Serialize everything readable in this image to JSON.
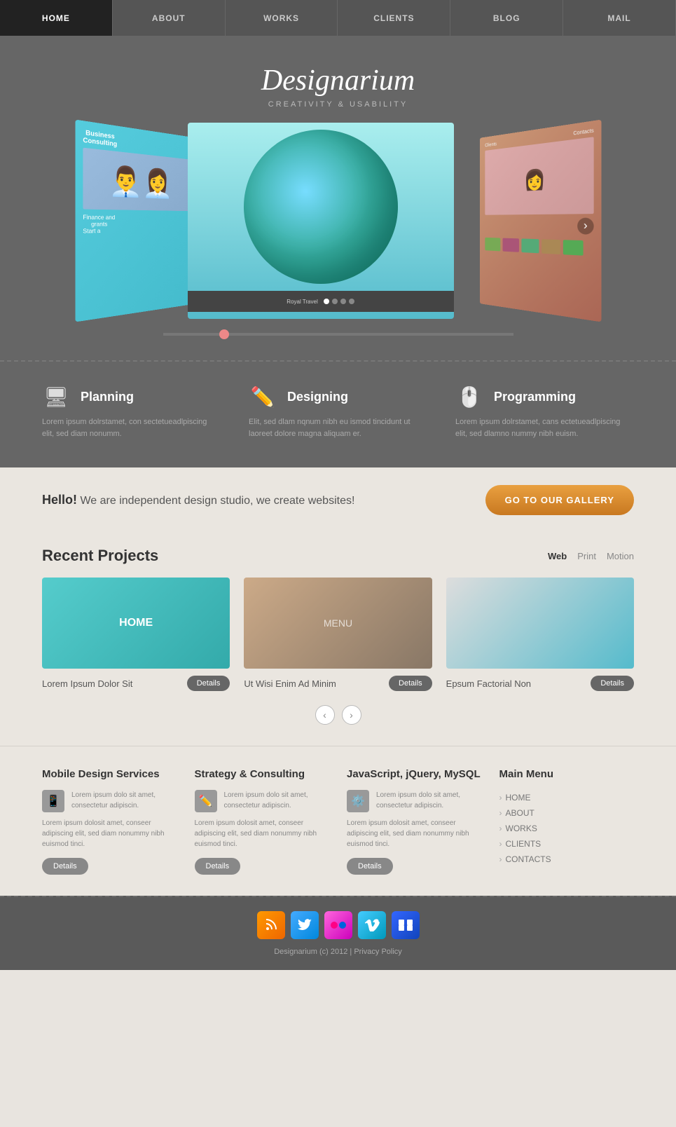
{
  "nav": {
    "items": [
      {
        "label": "HOME",
        "active": true
      },
      {
        "label": "ABOUT",
        "active": false
      },
      {
        "label": "WORKS",
        "active": false
      },
      {
        "label": "CLIENTS",
        "active": false
      },
      {
        "label": "BLOG",
        "active": false
      },
      {
        "label": "MAIL",
        "active": false
      }
    ]
  },
  "hero": {
    "title": "Designarium",
    "subtitle": "CREATIVITY & USABILITY"
  },
  "features": [
    {
      "id": "planning",
      "icon": "🖥",
      "title": "Planning",
      "text": "Lorem ipsum dolrstamet, con sectetueadlpiscing elit, sed diam nonumm."
    },
    {
      "id": "designing",
      "icon": "✏",
      "title": "Designing",
      "text": "Elit, sed dlam nqnum nibh eu ismod tincidunt ut laoreet dolore magna aliquam er."
    },
    {
      "id": "programming",
      "icon": "🖱",
      "title": "Programming",
      "text": "Lorem ipsum dolrstamet, cans ectetueadlpiscing elit, sed dlamno nummy nibh euism."
    }
  ],
  "hello": {
    "prefix": "Hello!",
    "text": " We are independent design studio, we create websites!",
    "button": "GO TO OUR GALLERY"
  },
  "recent": {
    "title": "Recent Projects",
    "filters": [
      "Web",
      "Print",
      "Motion"
    ],
    "active_filter": "Web",
    "projects": [
      {
        "name": "Lorem Ipsum Dolor Sit",
        "label": "HOME",
        "details_btn": "Details"
      },
      {
        "name": "Ut Wisi Enim Ad Minim",
        "label": "MENU",
        "details_btn": "Details"
      },
      {
        "name": "Epsum Factorial Non",
        "label": "",
        "details_btn": "Details"
      }
    ]
  },
  "footer_sections": [
    {
      "title": "Mobile Design Services",
      "icon": "📱",
      "short_text": "Lorem ipsum dolo sit amet, consectetur adipiscin.",
      "long_text": "Lorem ipsum dolosit amet, conseer adipiscing elit, sed diam nonummy nibh euismod tinci.",
      "btn": "Details"
    },
    {
      "title": "Strategy & Consulting",
      "icon": "✏",
      "short_text": "Lorem ipsum dolo sit amet, consectetur adipiscin.",
      "long_text": "Lorem ipsum dolosit amet, conseer adipiscing elit, sed diam nonummy nibh euismod tinci.",
      "btn": "Details"
    },
    {
      "title": "JavaScript, jQuery, MySQL",
      "icon": "⚙",
      "short_text": "Lorem ipsum dolo sit amet, consectetur adipiscin.",
      "long_text": "Lorem ipsum dolosit amet, conseer adipiscing elit, sed diam nonummy nibh euismod tinci.",
      "btn": "Details"
    },
    {
      "title": "Main Menu",
      "menu_items": [
        "HOME",
        "ABOUT",
        "WORKS",
        "CLIENTS",
        "CONTACTS"
      ]
    }
  ],
  "footer": {
    "copyright": "Designarium (c) 2012 | Privacy Policy"
  }
}
